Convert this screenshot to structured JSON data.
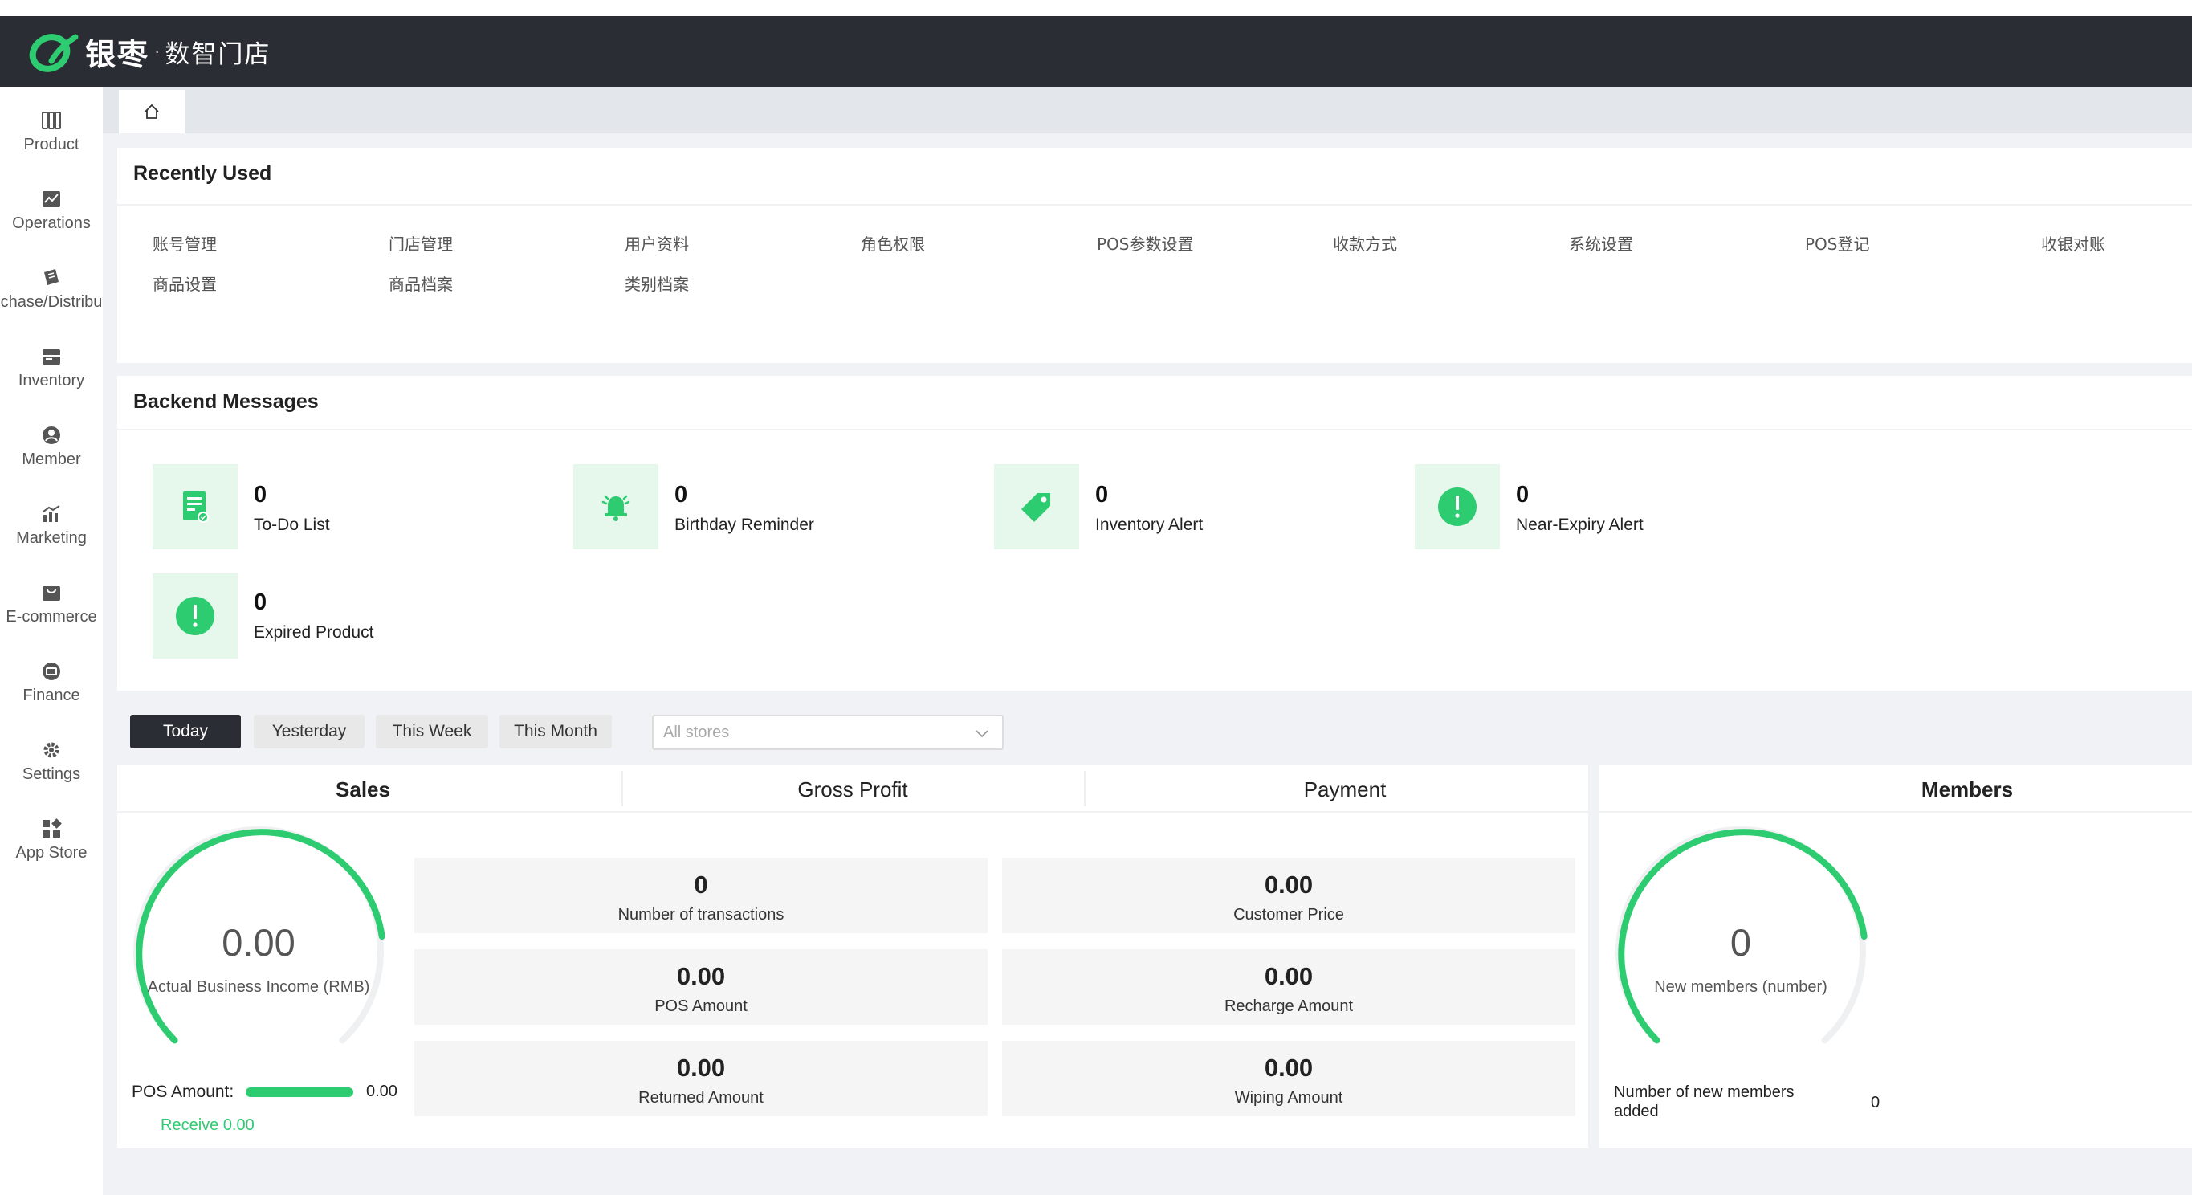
{
  "app": {
    "brand": "银枣",
    "brand_sub": "数智门店",
    "brand_dot": "·"
  },
  "colors": {
    "accent": "#2ecc71",
    "header_bg": "#2a2d33",
    "icon_bg": "#e6f7ec"
  },
  "sidebar": {
    "items": [
      {
        "label": "Product",
        "icon": "product-icon"
      },
      {
        "label": "Operations",
        "icon": "operations-icon"
      },
      {
        "label": "chase/Distribu",
        "icon": "purchase-icon"
      },
      {
        "label": "Inventory",
        "icon": "inventory-icon"
      },
      {
        "label": "Member",
        "icon": "member-icon"
      },
      {
        "label": "Marketing",
        "icon": "marketing-icon"
      },
      {
        "label": "E-commerce",
        "icon": "ecommerce-icon"
      },
      {
        "label": "Finance",
        "icon": "finance-icon"
      },
      {
        "label": "Settings",
        "icon": "gear-icon"
      },
      {
        "label": "App Store",
        "icon": "appstore-icon"
      }
    ]
  },
  "tabs": {
    "home_icon": "home-icon"
  },
  "recently_used": {
    "title": "Recently Used",
    "links": [
      "账号管理",
      "门店管理",
      "用户资料",
      "角色权限",
      "POS参数设置",
      "收款方式",
      "系统设置",
      "POS登记",
      "收银对账",
      "商品设置",
      "商品档案",
      "类别档案"
    ]
  },
  "messages": {
    "title": "Backend Messages",
    "items": [
      {
        "count": "0",
        "label": "To-Do List",
        "icon": "todo-icon"
      },
      {
        "count": "0",
        "label": "Birthday Reminder",
        "icon": "bell-icon"
      },
      {
        "count": "0",
        "label": "Inventory Alert",
        "icon": "tag-icon"
      },
      {
        "count": "0",
        "label": "Near-Expiry Alert",
        "icon": "alert-icon"
      },
      {
        "count": "0",
        "label": "Expired Product",
        "icon": "alert-icon"
      }
    ]
  },
  "filters": {
    "buttons": [
      "Today",
      "Yesterday",
      "This Week",
      "This Month"
    ],
    "active": "Today",
    "store_placeholder": "All stores"
  },
  "dashboard": {
    "sections": [
      "Sales",
      "Gross Profit",
      "Payment",
      "Members"
    ],
    "sales_gauge": {
      "value": "0.00",
      "label": "Actual Business Income (RMB)"
    },
    "pos_amount_label": "POS Amount:",
    "pos_amount_value": "0.00",
    "pos_amount_fill": 1.0,
    "receive_label": "Receive 0.00",
    "stats": [
      {
        "value": "0",
        "label": "Number of transactions"
      },
      {
        "value": "0.00",
        "label": "Customer Price"
      },
      {
        "value": "0.00",
        "label": "POS Amount"
      },
      {
        "value": "0.00",
        "label": "Recharge Amount"
      },
      {
        "value": "0.00",
        "label": "Returned Amount"
      },
      {
        "value": "0.00",
        "label": "Wiping Amount"
      }
    ],
    "members_gauge": {
      "value": "0",
      "label": "New members (number)"
    },
    "members_added_label": "Number of new members added",
    "members_added_value": "0"
  }
}
